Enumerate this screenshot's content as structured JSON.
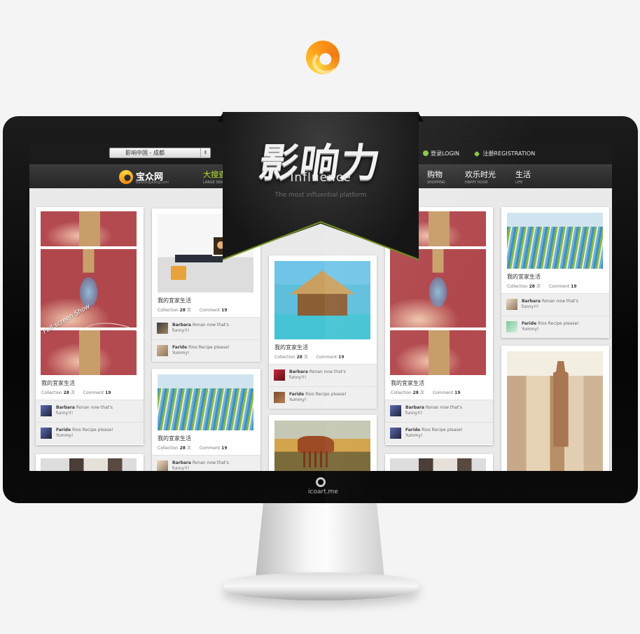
{
  "topbar": {
    "city": "影响中国 - 成都",
    "login": "登录LOGIN",
    "register": "注册REGISTRATION"
  },
  "site": {
    "name": "宝众网",
    "domain": "baozongwang.com"
  },
  "nav": [
    {
      "cn": "大搜查",
      "en": "LARGE SEARCH"
    },
    {
      "cn": "购物",
      "en": "SHOPPING"
    },
    {
      "cn": "欢乐时光",
      "en": "HAPPY HOUR"
    },
    {
      "cn": "生活",
      "en": "LIFE"
    }
  ],
  "banner": {
    "title": "影响力",
    "subtitle": "Influence",
    "tagline": "The most influential platform"
  },
  "hint": "Full screen  Show",
  "monitor_brand": "icoart.me",
  "card_common": {
    "title": "我的宜家生活",
    "collection_label": "Collection",
    "collection_count": "28",
    "collection_unit": "次",
    "comment_label": "Comment",
    "comment_count": "19"
  },
  "comments": {
    "c1_user": "Barbara",
    "c1_text": "Ronan now that's funny!!!",
    "c2_user": "Faride",
    "c2_text": "Rios Recipe please! Yummy!"
  },
  "colors": {
    "accent_green": "#b5e02a",
    "logo_orange": "#f08a12",
    "ribbon_green": "#6f8e1f"
  },
  "icons": [
    "login-user-icon",
    "register-tag-icon",
    "select-arrow-icon",
    "site-logo-icon"
  ]
}
